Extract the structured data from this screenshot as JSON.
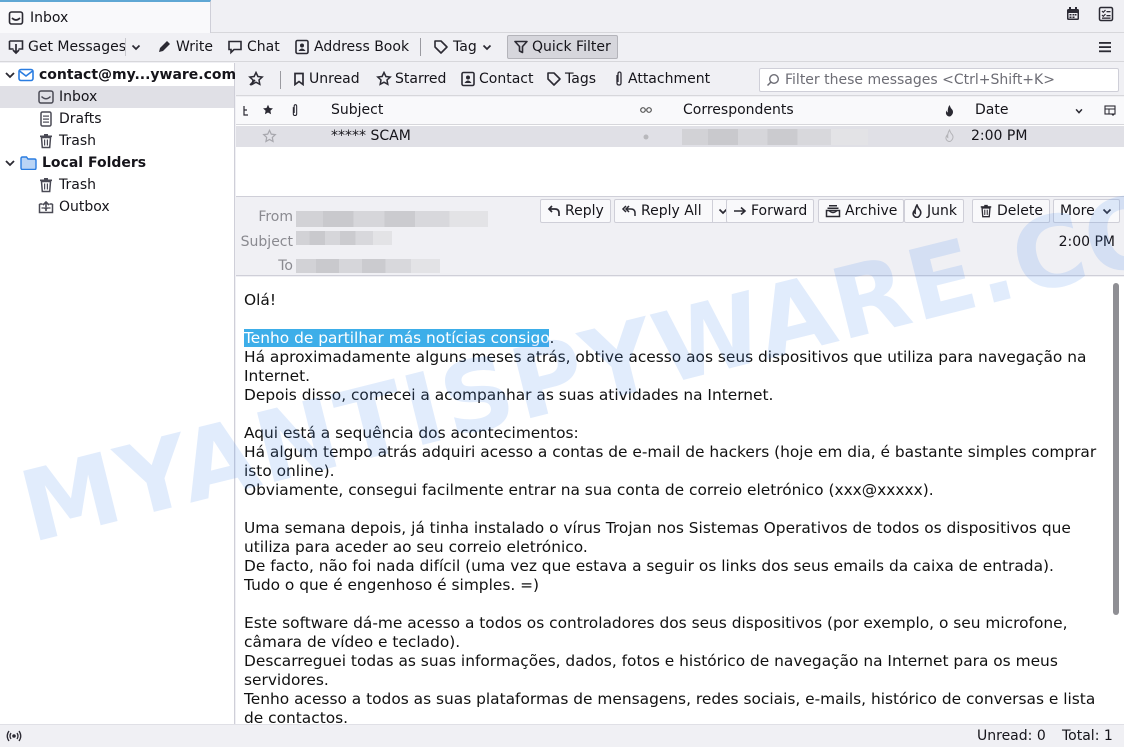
{
  "tabs": [
    {
      "label": "Inbox",
      "icon": "inbox-icon",
      "active": true
    }
  ],
  "top_icons": [
    {
      "name": "calendar-icon"
    },
    {
      "name": "tasks-icon"
    }
  ],
  "toolbar": {
    "get_messages": "Get Messages",
    "write": "Write",
    "chat": "Chat",
    "address_book": "Address Book",
    "tag": "Tag",
    "quick_filter": "Quick Filter",
    "menu_icon": "hamburger-menu-icon"
  },
  "folders": {
    "account": "contact@my...yware.com",
    "account_items": [
      {
        "label": "Inbox",
        "icon": "inbox-icon",
        "selected": true
      },
      {
        "label": "Drafts",
        "icon": "drafts-icon"
      },
      {
        "label": "Trash",
        "icon": "trash-icon"
      }
    ],
    "local": "Local Folders",
    "local_items": [
      {
        "label": "Trash",
        "icon": "trash-icon"
      },
      {
        "label": "Outbox",
        "icon": "outbox-icon"
      }
    ]
  },
  "quick_filter": {
    "unread": "Unread",
    "starred": "Starred",
    "contact": "Contact",
    "tags": "Tags",
    "attachment": "Attachment",
    "search_placeholder": "Filter these messages <Ctrl+Shift+K>"
  },
  "thread_columns": {
    "subject": "Subject",
    "correspondents": "Correspondents",
    "date": "Date"
  },
  "messages": [
    {
      "subject": "***** SCAM",
      "correspondent": "[redacted]",
      "date": "2:00 PM",
      "starred": false
    }
  ],
  "message_header": {
    "from_label": "From",
    "subject_label": "Subject",
    "to_label": "To",
    "date": "2:00 PM",
    "buttons": {
      "reply": "Reply",
      "reply_all": "Reply All",
      "forward": "Forward",
      "archive": "Archive",
      "junk": "Junk",
      "delete": "Delete",
      "more": "More"
    }
  },
  "body": {
    "greeting": "Olá!",
    "highlighted": "Tenho de partilhar más notícias consigo",
    "after_highlight": ".",
    "p1": [
      "Há aproximadamente alguns meses atrás, obtive acesso aos seus dispositivos que utiliza para navegação na Internet.",
      "Depois disso, comecei a acompanhar as suas atividades na Internet."
    ],
    "p2": [
      "Aqui está a sequência dos acontecimentos:",
      "Há algum tempo atrás adquiri acesso a contas de e-mail de hackers (hoje em dia, é bastante simples comprar isto online).",
      "Obviamente, consegui facilmente entrar na sua conta de correio eletrónico (xxx@xxxxx)."
    ],
    "p3": [
      "Uma semana depois, já tinha instalado o vírus Trojan nos Sistemas Operativos de todos os dispositivos que utiliza para aceder ao seu correio eletrónico.",
      "De facto, não foi nada difícil (uma vez que estava a seguir os links dos seus emails da caixa de entrada).",
      "Tudo o que é engenhoso é simples. =)"
    ],
    "p4": [
      "Este software dá-me acesso a todos os controladores dos seus dispositivos (por exemplo, o seu microfone, câmara de vídeo e teclado).",
      "Descarreguei todas as suas informações, dados, fotos e histórico de navegação na Internet para os meus servidores.",
      "Tenho acesso a todos as suas plataformas de mensagens, redes sociais, e-mails, histórico de conversas e lista de contactos."
    ]
  },
  "watermark": "MYANTISPYWARE.COM",
  "status": {
    "unread": "Unread: 0",
    "total": "Total: 1"
  }
}
